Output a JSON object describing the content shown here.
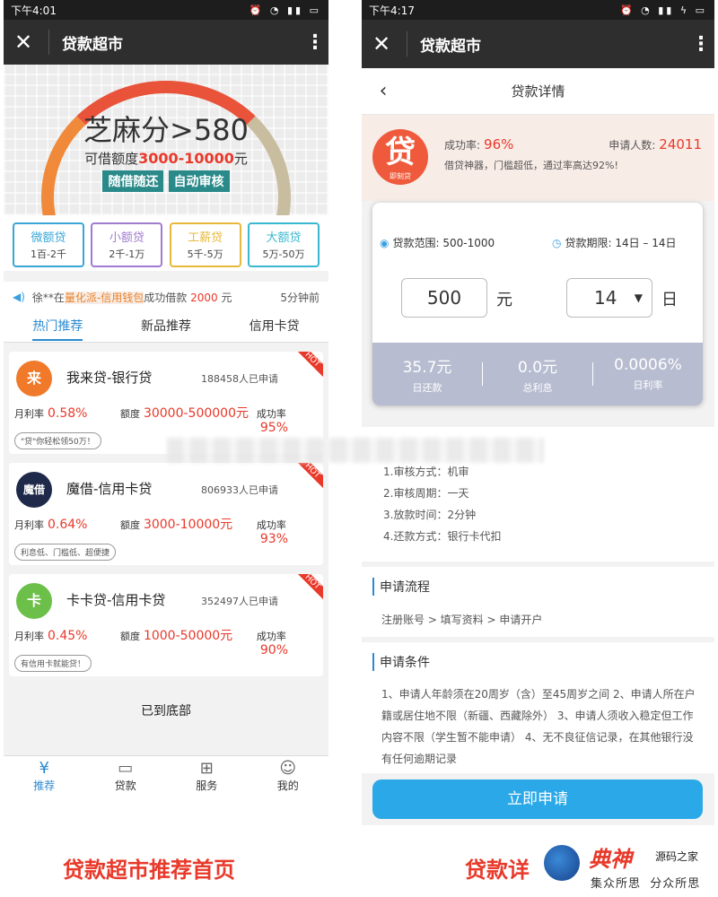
{
  "left": {
    "status": {
      "time": "下午4:01"
    },
    "appbar": {
      "title": "贷款超市"
    },
    "banner": {
      "headline": "芝麻分>580",
      "sub_prefix": "可借额度",
      "sub_amount": "3000-10000",
      "sub_suffix": "元",
      "tag1": "随借随还",
      "tag2": "自动审核"
    },
    "categories": [
      {
        "name": "微额贷",
        "range": "1百-2千",
        "color": "#3aa6d8"
      },
      {
        "name": "小额贷",
        "range": "2千-1万",
        "color": "#a07bd0"
      },
      {
        "name": "工薪贷",
        "range": "5千-5万",
        "color": "#e8b83a"
      },
      {
        "name": "大额贷",
        "range": "5万-50万",
        "color": "#3ab8d0"
      }
    ],
    "marquee": {
      "user": "徐**在",
      "product": "量化派-信用钱包",
      "mid": "成功借款",
      "amount": "2000",
      "unit": "元",
      "time": "5分钟前"
    },
    "tabs": [
      "热门推荐",
      "新品推荐",
      "信用卡贷"
    ],
    "products": [
      {
        "name": "我来贷-银行贷",
        "applied": "188458人已申请",
        "rate_label": "月利率",
        "rate": "0.58%",
        "amount_label": "额度",
        "amount": "30000-500000元",
        "success_label": "成功率",
        "success": "95%",
        "tag": "\"贷\"你轻松领50万！",
        "hot": "HOT",
        "logo_text": "来",
        "logo_color": "#f07a2a"
      },
      {
        "name": "魔借-信用卡贷",
        "applied": "806933人已申请",
        "rate_label": "月利率",
        "rate": "0.64%",
        "amount_label": "额度",
        "amount": "3000-10000元",
        "success_label": "成功率",
        "success": "93%",
        "tag": "利息低、门槛低、超便捷",
        "hot": "HOT",
        "logo_text": "魔借",
        "logo_color": "#1f2a4a"
      },
      {
        "name": "卡卡贷-信用卡贷",
        "applied": "352497人已申请",
        "rate_label": "月利率",
        "rate": "0.45%",
        "amount_label": "额度",
        "amount": "1000-50000元",
        "success_label": "成功率",
        "success": "90%",
        "tag": "有信用卡就能贷！",
        "hot": "HOT",
        "logo_text": "卡",
        "logo_color": "#6cc04a"
      }
    ],
    "bottom_msg": "已到底部",
    "nav": [
      "推荐",
      "贷款",
      "服务",
      "我的"
    ]
  },
  "right": {
    "status": {
      "time": "下午4:17"
    },
    "appbar": {
      "title": "贷款超市"
    },
    "subhead": {
      "title": "贷款详情"
    },
    "product": {
      "logo_char": "贷",
      "logo_sub": "即刻贷",
      "success_label": "成功率:",
      "success": "96%",
      "applicants_label": "申请人数:",
      "applicants": "24011",
      "desc": "借贷神器，门槛超低，通过率高达92%!"
    },
    "calc": {
      "range_label": "贷款范围: 500-1000",
      "term_label": "贷款期限: 14日 – 14日",
      "amount": "500",
      "amount_unit": "元",
      "term": "14",
      "term_unit": "日",
      "results": [
        {
          "value": "35.7元",
          "label": "日还款"
        },
        {
          "value": "0.0元",
          "label": "总利息"
        },
        {
          "value": "0.0006%",
          "label": "日利率"
        }
      ]
    },
    "details": [
      "1.审核方式：机审",
      "2.审核周期：一天",
      "3.放款时间：2分钟",
      "4.还款方式：银行卡代扣"
    ],
    "flow": {
      "title": "申请流程",
      "text": "注册账号 > 填写资料 > 申请开户"
    },
    "conditions": {
      "title": "申请条件",
      "text": "1、申请人年龄须在20周岁（含）至45周岁之间 2、申请人所在户籍或居住地不限（新疆、西藏除外） 3、申请人须收入稳定但工作内容不限（学生暂不能申请） 4、无不良征信记录，在其他银行没有任何逾期记录"
    },
    "apply_button": "立即申请"
  },
  "captions": {
    "left": "贷款超市推荐首页",
    "right": "贷款详"
  },
  "watermark": {
    "brand": "源码之家",
    "slogan1": "集众所思",
    "slogan2": "分众所思",
    "mark": "典神"
  }
}
